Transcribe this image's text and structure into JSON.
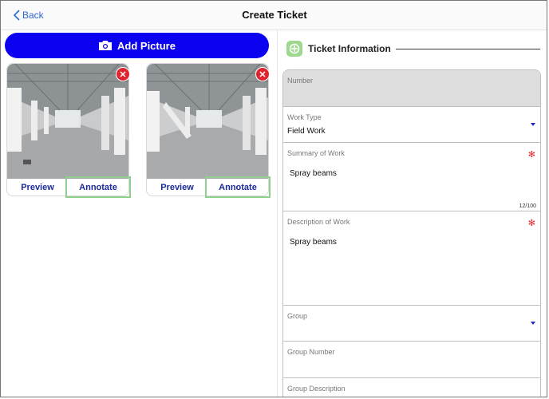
{
  "header": {
    "back_label": "Back",
    "title": "Create Ticket"
  },
  "media": {
    "add_picture_label": "Add Picture",
    "photos": [
      {
        "preview_label": "Preview",
        "annotate_label": "Annotate"
      },
      {
        "preview_label": "Preview",
        "annotate_label": "Annotate"
      }
    ]
  },
  "ticket": {
    "section_title": "Ticket Information",
    "fields": {
      "number": {
        "label": "Number",
        "value": ""
      },
      "work_type": {
        "label": "Work Type",
        "value": "Field Work"
      },
      "summary": {
        "label": "Summary of Work",
        "value": "Spray beams",
        "counter": "12/100"
      },
      "description": {
        "label": "Description of Work",
        "value": "Spray beams"
      },
      "group": {
        "label": "Group",
        "value": ""
      },
      "group_number": {
        "label": "Group Number",
        "value": ""
      },
      "group_description": {
        "label": "Group Description",
        "value": ""
      }
    }
  },
  "colors": {
    "accent": "#0b00f0",
    "link": "#2d67d6",
    "remove": "#e0242f",
    "required": "#e0242f",
    "highlight": "#8fd08f",
    "section_icon": "#9ed88e"
  }
}
